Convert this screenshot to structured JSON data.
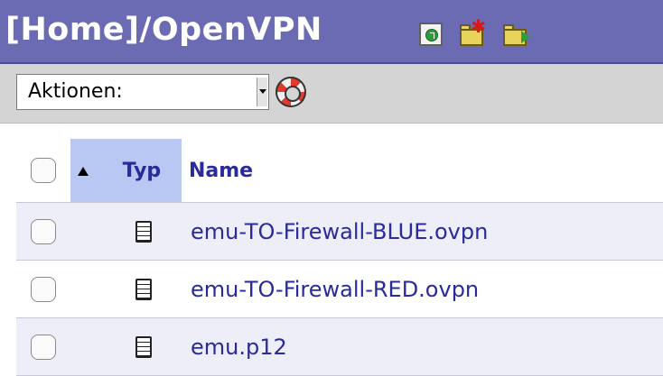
{
  "title": {
    "text": "[Home]/OpenVPN"
  },
  "toolbar_icons": [
    "refresh-icon",
    "new-folder-icon",
    "move-folder-icon"
  ],
  "actions": {
    "selected": "Aktionen:",
    "help_icon": "lifebuoy-icon"
  },
  "table": {
    "columns": [
      "",
      "Typ",
      "Name"
    ],
    "sort": {
      "column": "Typ",
      "direction": "asc"
    },
    "rows": [
      {
        "type_icon": "document-icon",
        "name": "emu-TO-Firewall-BLUE.ovpn"
      },
      {
        "type_icon": "document-icon",
        "name": "emu-TO-Firewall-RED.ovpn"
      },
      {
        "type_icon": "document-icon",
        "name": "emu.p12"
      }
    ]
  },
  "colors": {
    "titlebar": "#6b6bb3",
    "toolbar": "#d4d4d4",
    "link": "#2a2a9a",
    "sorted_column": "#b8c8f2",
    "row_stripe": "#eeeef8"
  }
}
